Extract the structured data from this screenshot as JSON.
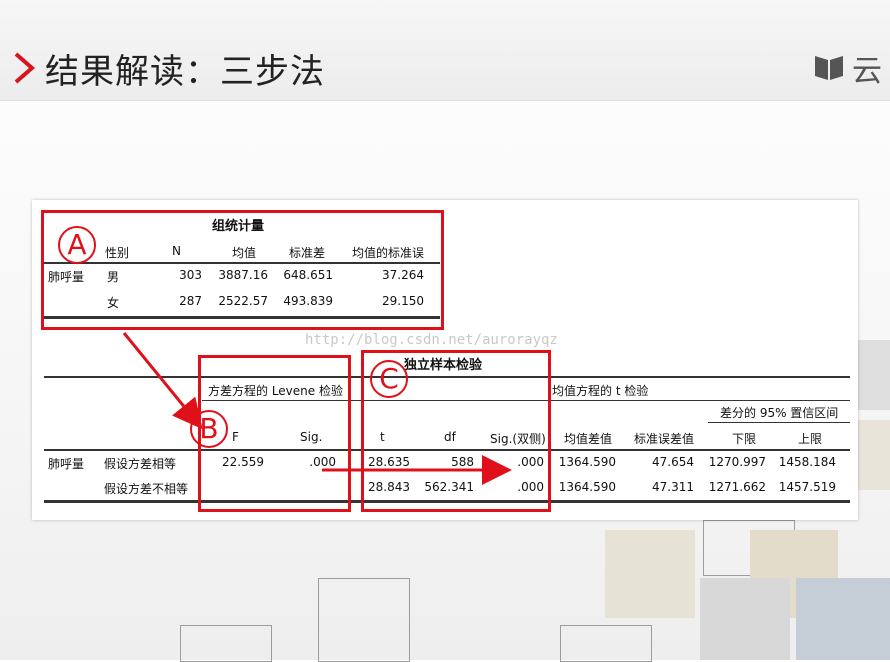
{
  "slide": {
    "title": "结果解读：三步法",
    "logo_text": "云",
    "watermark": "http://blog.csdn.net/aurorayqz"
  },
  "group_stats": {
    "title": "组统计量",
    "headers": [
      "性别",
      "N",
      "均值",
      "标准差",
      "均值的标准误"
    ],
    "row_label": "肺呼量",
    "rows": [
      {
        "sex": "男",
        "n": "303",
        "mean": "3887.16",
        "sd": "648.651",
        "se": "37.264"
      },
      {
        "sex": "女",
        "n": "287",
        "mean": "2522.57",
        "sd": "493.839",
        "se": "29.150"
      }
    ]
  },
  "ttest": {
    "title": "独立样本检验",
    "levene_header": "方差方程的 Levene 检验",
    "t_header": "均值方程的 t 检验",
    "ci_header": "差分的 95% 置信区间",
    "col_headers": [
      "F",
      "Sig.",
      "t",
      "df",
      "Sig.(双侧)",
      "均值差值",
      "标准误差值",
      "下限",
      "上限"
    ],
    "row_label": "肺呼量",
    "rows": [
      {
        "label": "假设方差相等",
        "F": "22.559",
        "sigF": ".000",
        "t": "28.635",
        "df": "588",
        "sig2": ".000",
        "md": "1364.590",
        "se": "47.654",
        "lo": "1270.997",
        "hi": "1458.184"
      },
      {
        "label": "假设方差不相等",
        "F": "",
        "sigF": "",
        "t": "28.843",
        "df": "562.341",
        "sig2": ".000",
        "md": "1364.590",
        "se": "47.311",
        "lo": "1271.662",
        "hi": "1457.519"
      }
    ]
  },
  "annotations": {
    "a": "A",
    "b": "B",
    "c": "C",
    "accent_color": "#e0101b"
  }
}
